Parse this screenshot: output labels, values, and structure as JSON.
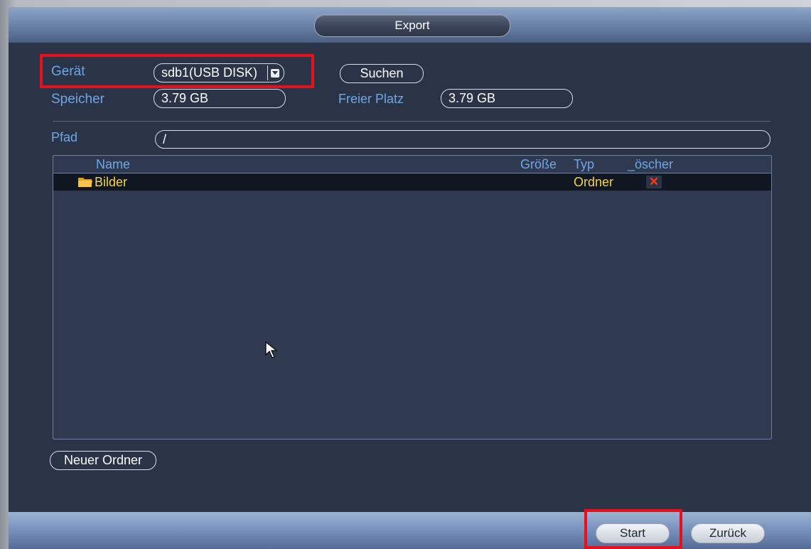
{
  "window": {
    "title": "Export"
  },
  "device": {
    "label": "Gerät",
    "selected": "sdb1(USB DISK)",
    "search_button": "Suchen"
  },
  "storage": {
    "capacity_label": "Speicher",
    "capacity_value": "3.79 GB",
    "free_label": "Freier Platz",
    "free_value": "3.79 GB"
  },
  "path": {
    "label": "Pfad",
    "value": "/"
  },
  "file_list": {
    "columns": {
      "name": "Name",
      "size": "Größe",
      "type": "Typ",
      "delete": "_öscher"
    },
    "rows": [
      {
        "name": "Bilder",
        "size": "",
        "type": "Ordner",
        "icon": "folder-icon",
        "delete_icon": "close-icon"
      }
    ]
  },
  "new_folder_button": "Neuer Ordner",
  "footer": {
    "start_button": "Start",
    "back_button": "Zurück"
  },
  "colors": {
    "background": "#2b3447",
    "label_blue": "#6fa6e6",
    "folder_text": "#f3d34b",
    "highlight_red": "#e8101c",
    "delete_red": "#ff3a1a"
  }
}
